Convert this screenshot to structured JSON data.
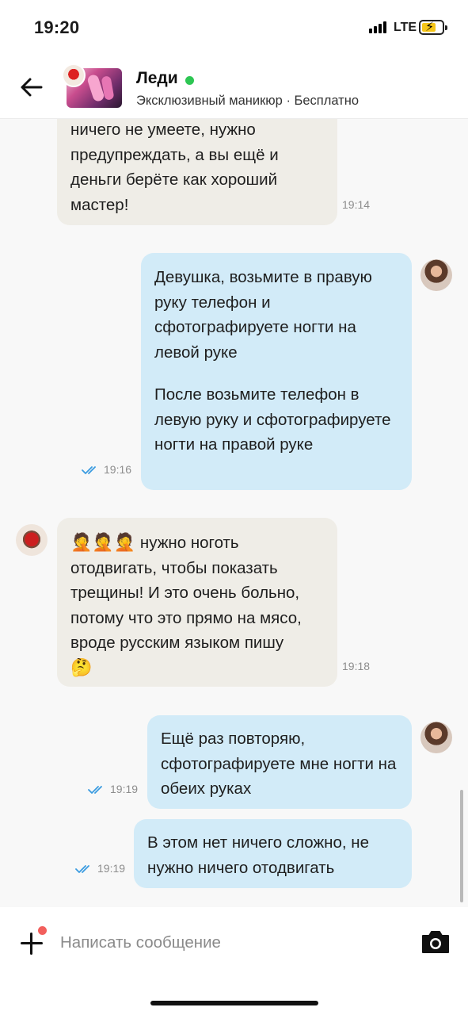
{
  "status_bar": {
    "time": "19:20",
    "network": "LTE"
  },
  "header": {
    "name": "Леди",
    "subtitle": "Эксклюзивный маникюр · Бесплатно"
  },
  "messages": [
    {
      "direction": "in",
      "paragraphs": [
        "ничего не умеете, нужно предупреждать, а вы ещё и деньги берёте как хороший мастер!"
      ],
      "time": "19:14"
    },
    {
      "direction": "out",
      "paragraphs": [
        "Девушка, возьмите в правую руку телефон и сфотографируете ногти на левой руке",
        "После возьмите телефон в левую руку и сфотографируете ногти на правой руке"
      ],
      "time": "19:16",
      "read": true
    },
    {
      "direction": "in",
      "emoji_prefix": "🤦🤦🤦",
      "paragraphs": [
        "нужно ноготь отодвигать, чтобы показать трещины! И это очень больно, потому что это прямо на мясо, вроде русским языком пишу"
      ],
      "emoji_suffix": "🤔",
      "time": "19:18"
    },
    {
      "direction": "out",
      "paragraphs": [
        "Ещё раз повторяю, сфотографируете мне ногти на обеих руках"
      ],
      "time": "19:19",
      "read": true
    },
    {
      "direction": "out",
      "paragraphs": [
        "В этом нет ничего сложно, не нужно ничего отодвигать"
      ],
      "time": "19:19",
      "read": true
    }
  ],
  "composer": {
    "placeholder": "Написать сообщение"
  },
  "colors": {
    "incoming_bubble": "#efede7",
    "outgoing_bubble": "#d2ebf8",
    "online": "#2dc653",
    "read_ticks": "#3a9be0",
    "notify_dot": "#f25f5c"
  },
  "icons": [
    "back-arrow-icon",
    "online-dot-icon",
    "double-check-icon",
    "plus-icon",
    "camera-icon"
  ]
}
